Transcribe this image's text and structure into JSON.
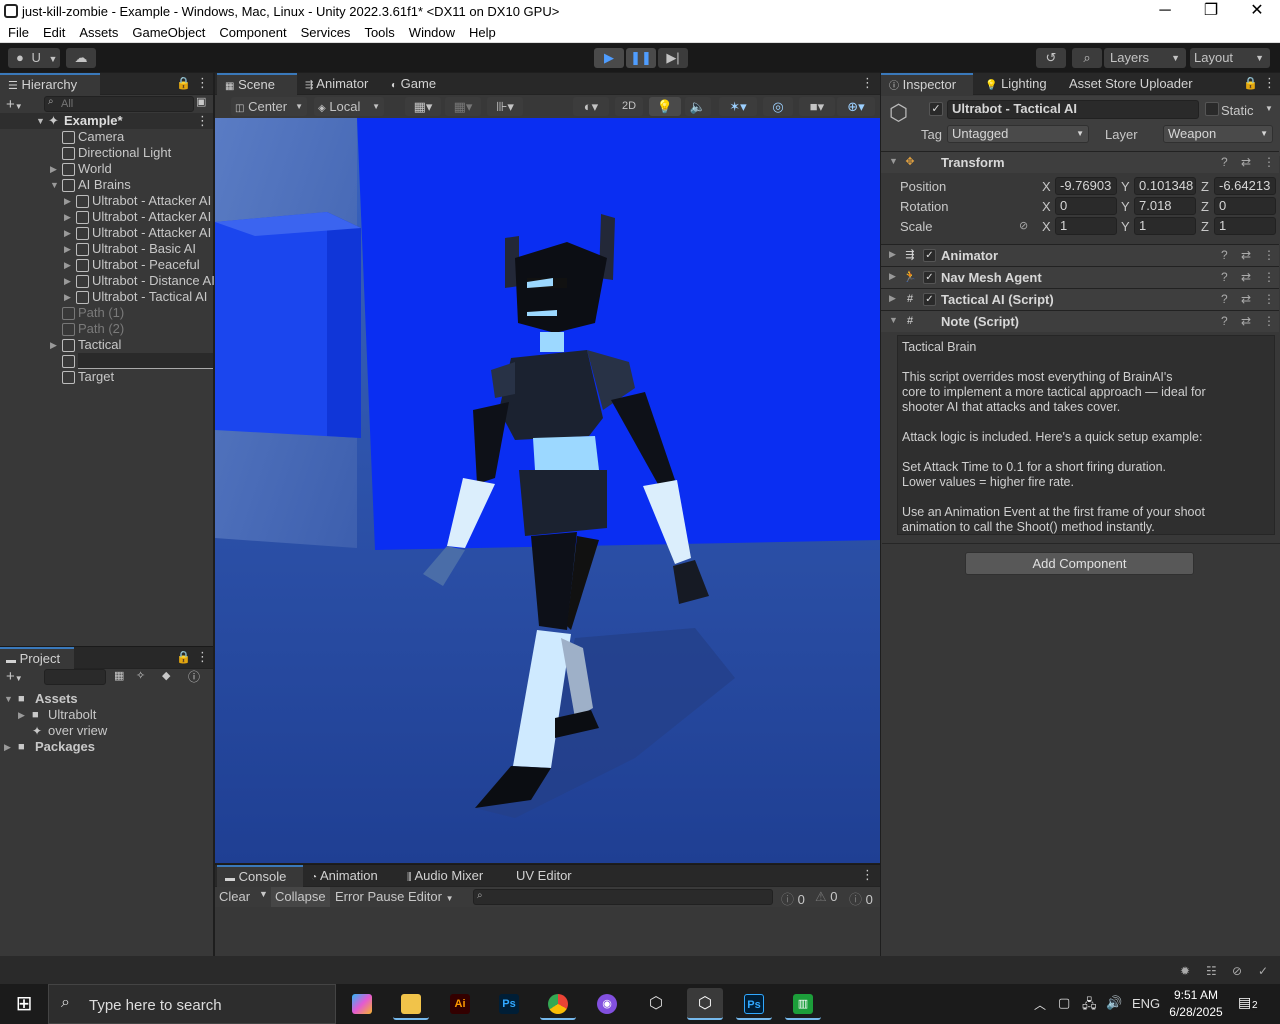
{
  "window": {
    "title": "just-kill-zombie - Example - Windows, Mac, Linux - Unity 2022.3.61f1* <DX11 on DX10 GPU>",
    "minimize": "─",
    "maximize": "❐",
    "close": "✕"
  },
  "menu": [
    "File",
    "Edit",
    "Assets",
    "GameObject",
    "Component",
    "Services",
    "Tools",
    "Window",
    "Help"
  ],
  "toolbar": {
    "account": "U",
    "play_icon": "play-icon",
    "pause_icon": "pause-icon",
    "step_icon": "step-icon",
    "layers": "Layers",
    "layout": "Layout"
  },
  "hierarchy": {
    "tab": "Hierarchy",
    "search_placeholder": "All",
    "scene": "Example*",
    "items": [
      {
        "label": "Camera",
        "depth": 1,
        "arrow": false,
        "dim": false
      },
      {
        "label": "Directional Light",
        "depth": 1,
        "arrow": false,
        "dim": false
      },
      {
        "label": "World",
        "depth": 1,
        "arrow": true,
        "dim": false
      },
      {
        "label": "AI Brains",
        "depth": 1,
        "arrow": true,
        "expanded": true,
        "dim": false
      },
      {
        "label": "Ultrabot - Attacker AI",
        "depth": 2,
        "arrow": true,
        "dim": false
      },
      {
        "label": "Ultrabot - Attacker AI",
        "depth": 2,
        "arrow": true,
        "dim": false
      },
      {
        "label": "Ultrabot - Attacker AI",
        "depth": 2,
        "arrow": true,
        "dim": false
      },
      {
        "label": "Ultrabot - Basic AI",
        "depth": 2,
        "arrow": true,
        "dim": false
      },
      {
        "label": "Ultrabot - Peaceful",
        "depth": 2,
        "arrow": true,
        "dim": false
      },
      {
        "label": "Ultrabot - Distance AI",
        "depth": 2,
        "arrow": true,
        "dim": false
      },
      {
        "label": "Ultrabot - Tactical AI",
        "depth": 2,
        "arrow": true,
        "dim": false
      },
      {
        "label": "Path (1)",
        "depth": 1,
        "arrow": false,
        "dim": true
      },
      {
        "label": "Path (2)",
        "depth": 1,
        "arrow": false,
        "dim": true
      },
      {
        "label": "Tactical",
        "depth": 1,
        "arrow": true,
        "dim": false
      },
      {
        "label": "",
        "depth": 1,
        "arrow": false,
        "dim": false
      },
      {
        "label": "Target",
        "depth": 1,
        "arrow": false,
        "dim": false
      }
    ]
  },
  "scene_view": {
    "tabs": [
      "Scene",
      "Animator",
      "Game"
    ],
    "pivot": "Center",
    "space": "Local",
    "mode_2d": "2D"
  },
  "project": {
    "tab": "Project",
    "items": [
      {
        "label": "Assets",
        "bold": true
      },
      {
        "label": "Ultrabolt",
        "bold": false
      },
      {
        "label": "over vriew",
        "bold": false
      },
      {
        "label": "Packages",
        "bold": true
      }
    ]
  },
  "console": {
    "tabs": [
      "Console",
      "Animation",
      "Audio Mixer",
      "UV Editor"
    ],
    "clear": "Clear",
    "collapse": "Collapse",
    "error_pause": "Error Pause",
    "editor": "Editor",
    "log_count": "0",
    "warn_count": "0",
    "error_count": "0"
  },
  "inspector": {
    "tabs": [
      "Inspector",
      "Lighting",
      "Asset Store Uploader"
    ],
    "object_name": "Ultrabot - Tactical AI",
    "static_label": "Static",
    "tag_label": "Tag",
    "tag_value": "Untagged",
    "layer_label": "Layer",
    "layer_value": "Weapon",
    "transform": {
      "title": "Transform",
      "position_label": "Position",
      "rotation_label": "Rotation",
      "scale_label": "Scale",
      "position": {
        "x": "-9.76903",
        "y": "0.101348",
        "z": "-6.64213"
      },
      "rotation": {
        "x": "0",
        "y": "7.018",
        "z": "0"
      },
      "scale": {
        "x": "1",
        "y": "1",
        "z": "1"
      }
    },
    "components": [
      "Animator",
      "Nav Mesh Agent",
      "Tactical AI (Script)",
      "Note (Script)"
    ],
    "note_lines": [
      "Tactical Brain",
      "",
      "This script overrides most everything of BrainAI's",
      "core to implement  a more tactical approach — ideal for",
      "shooter AI that attacks and takes cover.",
      "",
      "Attack logic is included. Here's a quick setup example:",
      "",
      "Set Attack Time to 0.1 for a short firing duration.",
      "Lower values = higher fire rate.",
      "",
      "Use an Animation Event at the first frame of your shoot",
      "animation to call the Shoot() method instantly."
    ],
    "add_component": "Add Component"
  },
  "taskbar": {
    "search_placeholder": "Type here to search",
    "language": "ENG",
    "time": "9:51 AM",
    "date": "6/28/2025",
    "notification_count": "2"
  },
  "colors": {
    "accent": "#3a79bb",
    "scene_wall": "#0a2ef2",
    "scene_floor": "#2b4fa6"
  }
}
